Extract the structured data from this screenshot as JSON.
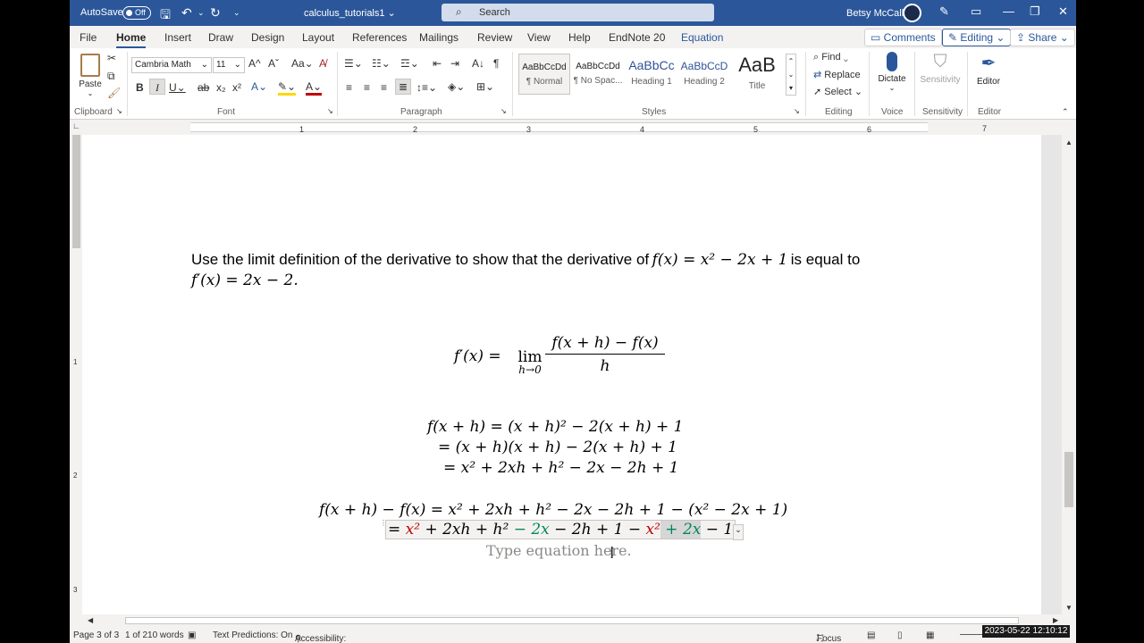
{
  "titlebar": {
    "autosave_label": "AutoSave",
    "autosave_state": "Off",
    "doc_title": "calculus_tutorials1",
    "search_placeholder": "Search",
    "user_name": "Betsy McCall"
  },
  "tabs": [
    "File",
    "Home",
    "Insert",
    "Draw",
    "Design",
    "Layout",
    "References",
    "Mailings",
    "Review",
    "View",
    "Help",
    "EndNote 20",
    "Equation"
  ],
  "tab_buttons": {
    "comments": "Comments",
    "editing": "Editing",
    "share": "Share"
  },
  "ribbon": {
    "clipboard": {
      "paste": "Paste",
      "label": "Clipboard"
    },
    "font": {
      "name": "Cambria Math",
      "size": "11",
      "label": "Font"
    },
    "paragraph": {
      "label": "Paragraph"
    },
    "styles": {
      "items": [
        {
          "sample": "AaBbCcDd",
          "name": "¶ Normal"
        },
        {
          "sample": "AaBbCcDd",
          "name": "¶ No Spac..."
        },
        {
          "sample": "AaBbCc",
          "name": "Heading 1"
        },
        {
          "sample": "AaBbCcD",
          "name": "Heading 2"
        },
        {
          "sample": "AaB",
          "name": "Title"
        }
      ],
      "label": "Styles"
    },
    "editing": {
      "find": "Find",
      "replace": "Replace",
      "select": "Select",
      "label": "Editing"
    },
    "voice": {
      "dictate": "Dictate",
      "label": "Voice"
    },
    "sensitivity": {
      "button": "Sensitivity",
      "label": "Sensitivity"
    },
    "editor": {
      "button": "Editor",
      "label": "Editor"
    }
  },
  "ruler_numbers": [
    "1",
    "2",
    "3",
    "4",
    "5",
    "6",
    "7"
  ],
  "vruler_numbers": [
    "1",
    "1",
    "2",
    "3"
  ],
  "document": {
    "problem_text_1": "Use the limit definition of the derivative to show that the derivative of",
    "problem_math_1": "f(x) = x² − 2x + 1",
    "problem_text_2": "is equal to",
    "problem_math_2": "f′(x) = 2x − 2.",
    "def_lhs": "f′(x) = ",
    "def_lim": "lim",
    "def_sub": "h→0",
    "def_num": "f(x + h) − f(x)",
    "def_den": "h",
    "expand_1": "f(x + h) = (x + h)² − 2(x + h) + 1",
    "expand_2": "= (x + h)(x + h) − 2(x + h) + 1",
    "expand_3": "= x² + 2xh + h² − 2x − 2h + 1",
    "diff_1": "f(x + h) − f(x) = x² + 2xh + h² − 2x − 2h + 1 − (x² − 2x + 1)",
    "diff_2": {
      "eq": "= ",
      "t1": "x²",
      "t2": " + 2xh + h² ",
      "t3": "− 2x",
      "t4": " − 2h + 1 − ",
      "t5": "x²",
      "t6": " + 2x",
      "t7": " − 1"
    },
    "placeholder": "Type equation here."
  },
  "status": {
    "page": "Page 3 of 3",
    "words": "1 of 210 words",
    "text_predictions": "Text Predictions: On",
    "accessibility": "Accessibility: Investigate",
    "focus": "Focus",
    "timestamp": "2023-05-22  12:10:12"
  }
}
